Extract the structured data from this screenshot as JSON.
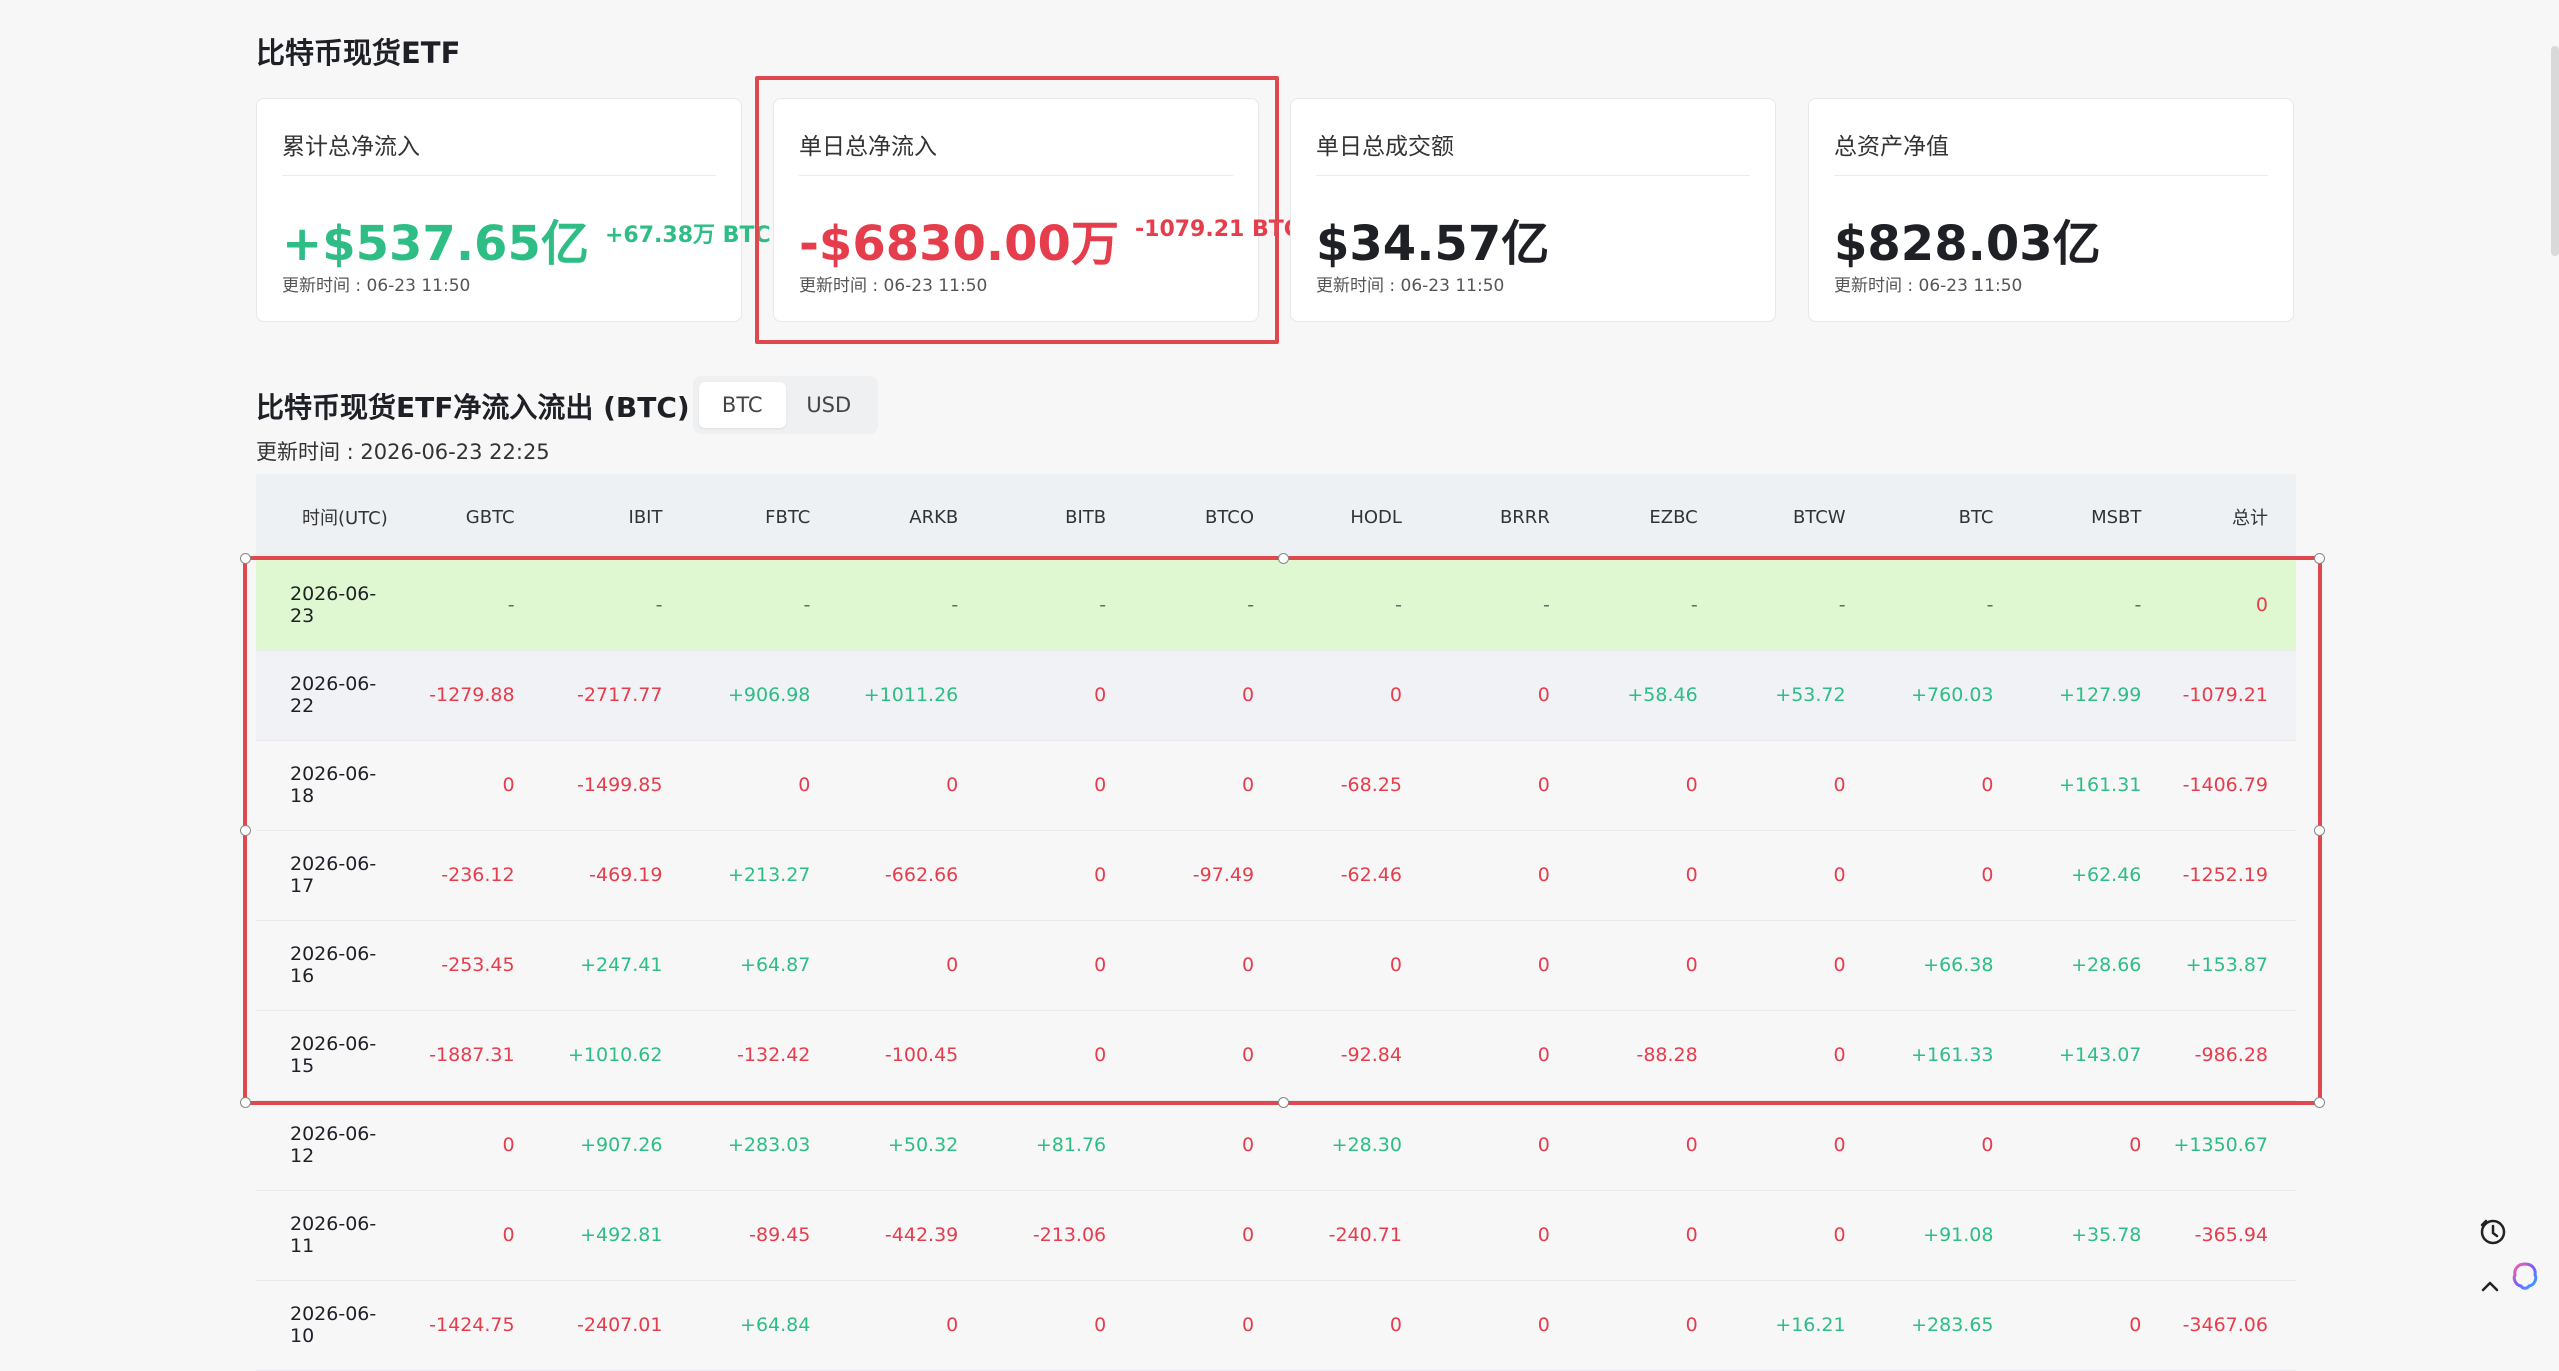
{
  "page_title": "比特币现货ETF",
  "cards": [
    {
      "label": "累计总净流入",
      "value": "+$537.65亿",
      "value_color": "#2ebd85",
      "sub": "+67.38万 BTC",
      "sub_color": "#2ebd85",
      "updated": "更新时间 : 06-23 11:50"
    },
    {
      "label": "单日总净流入",
      "value": "-$6830.00万",
      "value_color": "#e63d4c",
      "sub": "-1079.21 BTC",
      "sub_color": "#e63d4c",
      "updated": "更新时间 : 06-23 11:50"
    },
    {
      "label": "单日总成交额",
      "value": "$34.57亿",
      "value_color": "#1e2026",
      "sub": "",
      "sub_color": "",
      "updated": "更新时间 : 06-23 11:50"
    },
    {
      "label": "总资产净值",
      "value": "$828.03亿",
      "value_color": "#1e2026",
      "sub": "",
      "sub_color": "",
      "updated": "更新时间 : 06-23 11:50"
    }
  ],
  "flows": {
    "title": "比特币现货ETF净流入流出 (BTC)",
    "toggle": [
      "BTC",
      "USD"
    ],
    "active_toggle": "BTC",
    "updated": "更新时间 : 2026-06-23 22:25",
    "columns": [
      "时间(UTC)",
      "GBTC",
      "IBIT",
      "FBTC",
      "ARKB",
      "BITB",
      "BTCO",
      "HODL",
      "BRRR",
      "EZBC",
      "BTCW",
      "BTC",
      "MSBT",
      "总计"
    ],
    "rows": [
      [
        "2026-06-23",
        "-",
        "-",
        "-",
        "-",
        "-",
        "-",
        "-",
        "-",
        "-",
        "-",
        "-",
        "-",
        "0"
      ],
      [
        "2026-06-22",
        "-1279.88",
        "-2717.77",
        "+906.98",
        "+1011.26",
        "0",
        "0",
        "0",
        "0",
        "+58.46",
        "+53.72",
        "+760.03",
        "+127.99",
        "-1079.21"
      ],
      [
        "2026-06-18",
        "0",
        "-1499.85",
        "0",
        "0",
        "0",
        "0",
        "-68.25",
        "0",
        "0",
        "0",
        "0",
        "+161.31",
        "-1406.79"
      ],
      [
        "2026-06-17",
        "-236.12",
        "-469.19",
        "+213.27",
        "-662.66",
        "0",
        "-97.49",
        "-62.46",
        "0",
        "0",
        "0",
        "0",
        "+62.46",
        "-1252.19"
      ],
      [
        "2026-06-16",
        "-253.45",
        "+247.41",
        "+64.87",
        "0",
        "0",
        "0",
        "0",
        "0",
        "0",
        "0",
        "+66.38",
        "+28.66",
        "+153.87"
      ],
      [
        "2026-06-15",
        "-1887.31",
        "+1010.62",
        "-132.42",
        "-100.45",
        "0",
        "0",
        "-92.84",
        "0",
        "-88.28",
        "0",
        "+161.33",
        "+143.07",
        "-986.28"
      ],
      [
        "2026-06-12",
        "0",
        "+907.26",
        "+283.03",
        "+50.32",
        "+81.76",
        "0",
        "+28.30",
        "0",
        "0",
        "0",
        "0",
        "0",
        "+1350.67"
      ],
      [
        "2026-06-11",
        "0",
        "+492.81",
        "-89.45",
        "-442.39",
        "-213.06",
        "0",
        "-240.71",
        "0",
        "0",
        "0",
        "+91.08",
        "+35.78",
        "-365.94"
      ],
      [
        "2026-06-10",
        "-1424.75",
        "-2407.01",
        "+64.84",
        "0",
        "0",
        "0",
        "0",
        "0",
        "0",
        "+16.21",
        "+283.65",
        "0",
        "-3467.06"
      ]
    ]
  },
  "colors": {
    "positive": "#2ebd85",
    "negative": "#e63d4c",
    "highlight": "#e04850"
  },
  "icons": [
    "info-icon",
    "ai-assistant-icon",
    "back-to-top-icon"
  ]
}
